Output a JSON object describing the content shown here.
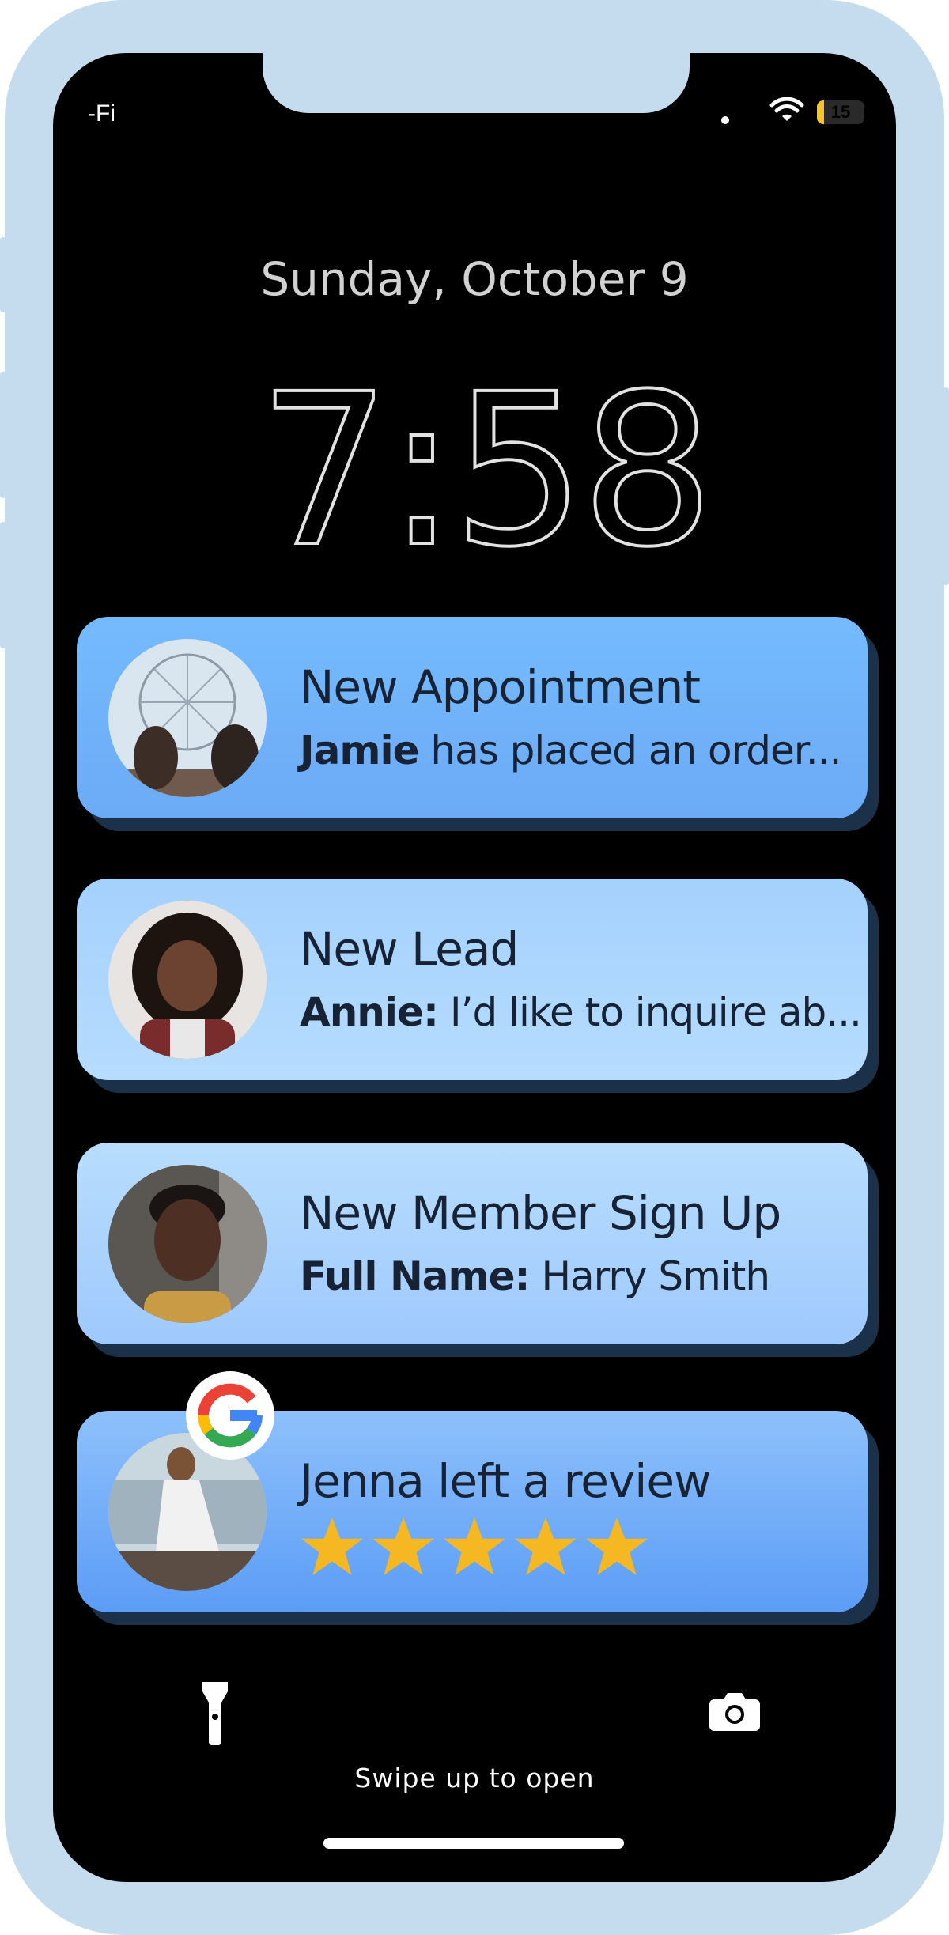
{
  "status_bar": {
    "carrier": "-Fi",
    "battery_level": "15",
    "battery_fraction": 0.15
  },
  "lock_screen": {
    "date": "Sunday, October 9",
    "time": "7:58"
  },
  "notifications": [
    {
      "title": "New Appointment",
      "body_bold": "Jamie",
      "body_text": " has placed an order...",
      "avatar_icon": "ferris-wheel-photo-avatar"
    },
    {
      "title": "New Lead",
      "body_bold": "Annie:",
      "body_text": " I’d like to inquire ab...",
      "avatar_icon": "woman-photo-avatar"
    },
    {
      "title": "New Member Sign Up",
      "body_bold": "Full Name:",
      "body_text": " Harry Smith",
      "avatar_icon": "man-photo-avatar"
    },
    {
      "title": "Jenna left a review",
      "rating": 5,
      "rating_max": 5,
      "avatar_icon": "beach-photo-avatar",
      "badge_icon": "google-icon"
    }
  ],
  "footer": {
    "swipe_label": "Swipe up to open",
    "left_icon": "flashlight-icon",
    "right_icon": "camera-icon"
  },
  "colors": {
    "frame": "#c5dcef",
    "screen": "#000000",
    "star": "#f5b823",
    "card_text": "#172234"
  }
}
